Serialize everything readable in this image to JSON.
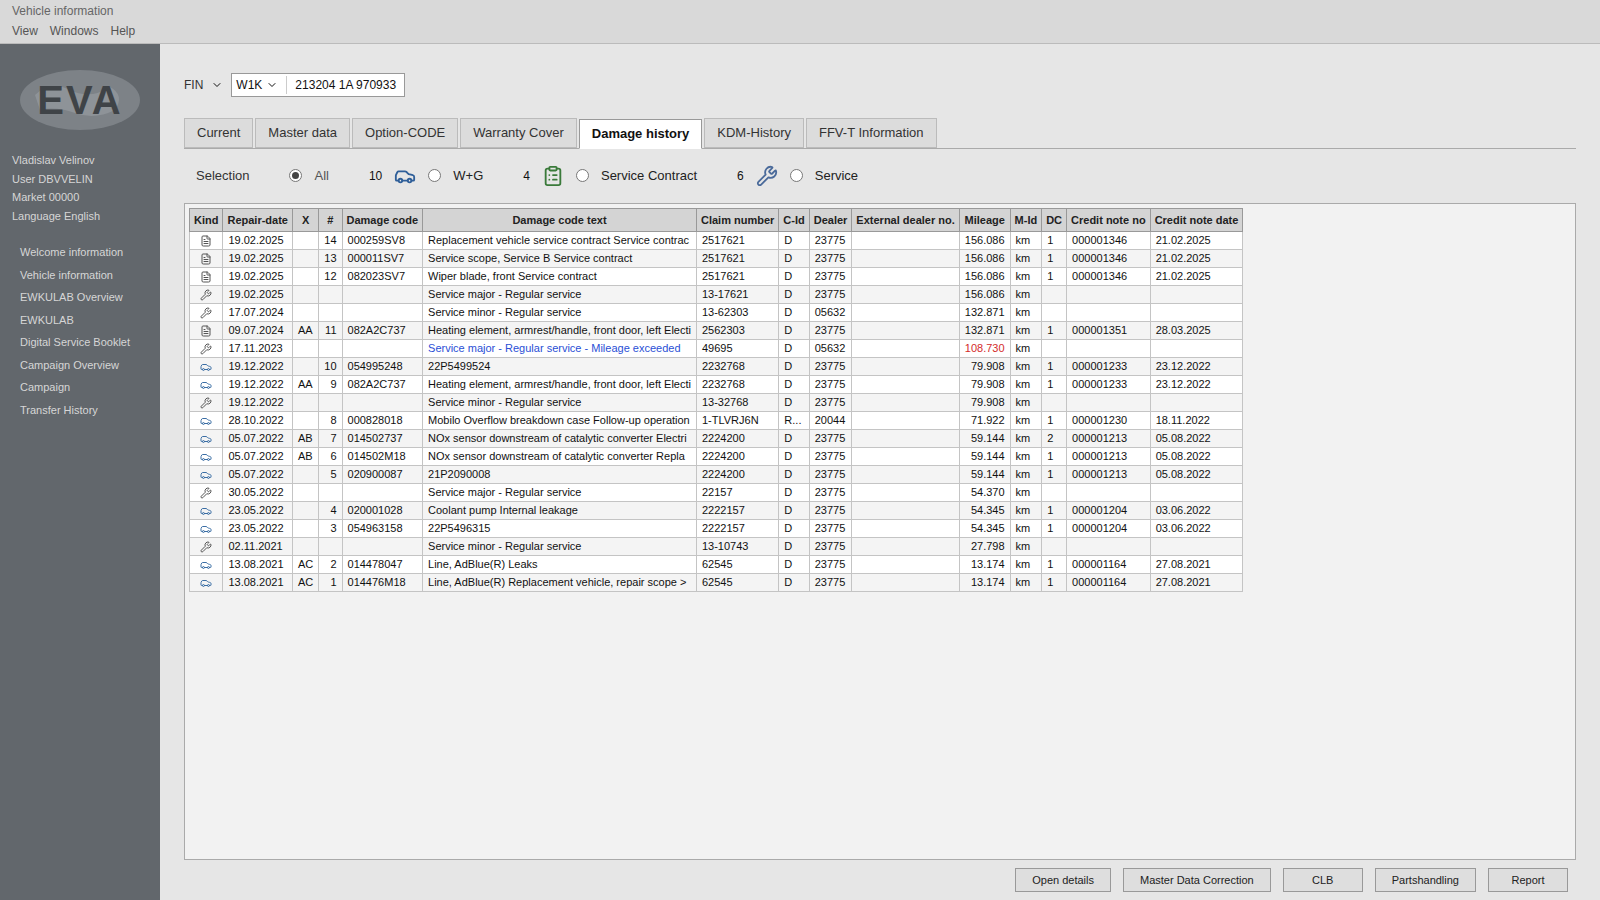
{
  "window": {
    "title": "Vehicle information"
  },
  "menu": [
    "View",
    "Windows",
    "Help"
  ],
  "sidebar": {
    "logo": "EVA",
    "user_lines": [
      "Vladislav Velinov",
      "User DBVVELIN",
      "Market 00000",
      "Language English"
    ],
    "items": [
      "Welcome information",
      "Vehicle information",
      "EWKULAB Overview",
      "EWKULAB",
      "Digital Service Booklet",
      "Campaign Overview",
      "Campaign",
      "Transfer History"
    ]
  },
  "fin": {
    "label": "FIN",
    "prefix": "W1K",
    "value": "213204 1A 970933"
  },
  "tabs": [
    {
      "label": "Current",
      "selected": false
    },
    {
      "label": "Master data",
      "selected": false
    },
    {
      "label": "Option-CODE",
      "selected": false
    },
    {
      "label": "Warranty Cover",
      "selected": false
    },
    {
      "label": "Damage history",
      "selected": true
    },
    {
      "label": "KDM-History",
      "selected": false
    },
    {
      "label": "FFV-T Information",
      "selected": false
    }
  ],
  "selection": {
    "label": "Selection",
    "filters": [
      {
        "label": "All",
        "selected": true,
        "count": "",
        "kind": "none"
      },
      {
        "label": "W+G",
        "selected": false,
        "count": "10",
        "kind": "damage"
      },
      {
        "label": "Service Contract",
        "selected": false,
        "count": "4",
        "kind": "contract"
      },
      {
        "label": "Service",
        "selected": false,
        "count": "6",
        "kind": "service"
      }
    ]
  },
  "table": {
    "columns": [
      {
        "key": "kind",
        "label": "Kind"
      },
      {
        "key": "date",
        "label": "Repair-date"
      },
      {
        "key": "x",
        "label": "X"
      },
      {
        "key": "no",
        "label": "#"
      },
      {
        "key": "code",
        "label": "Damage code"
      },
      {
        "key": "text",
        "label": "Damage code text"
      },
      {
        "key": "claim",
        "label": "Claim number"
      },
      {
        "key": "cid",
        "label": "C-Id"
      },
      {
        "key": "dealer",
        "label": "Dealer"
      },
      {
        "key": "external",
        "label": "External dealer no."
      },
      {
        "key": "mileage",
        "label": "Mileage"
      },
      {
        "key": "unit",
        "label": "M-Id"
      },
      {
        "key": "dc",
        "label": "DC"
      },
      {
        "key": "creditNo",
        "label": "Credit note no"
      },
      {
        "key": "creditDate",
        "label": "Credit note date"
      }
    ],
    "rows": [
      {
        "kind": "contract",
        "date": "19.02.2025",
        "x": "",
        "no": "14",
        "code": "000259SV8",
        "text": "Replacement vehicle service contract Service contrac",
        "claim": "2517621",
        "cid": "D",
        "dealer": "23775",
        "external": "",
        "mileage": "156.086",
        "unit": "km",
        "dc": "1",
        "creditNo": "000001346",
        "creditDate": "21.02.2025",
        "textColor": "#111111",
        "mileageColor": "#111111"
      },
      {
        "kind": "contract",
        "date": "19.02.2025",
        "x": "",
        "no": "13",
        "code": "000011SV7",
        "text": "Service scope, Service B Service contract",
        "claim": "2517621",
        "cid": "D",
        "dealer": "23775",
        "external": "",
        "mileage": "156.086",
        "unit": "km",
        "dc": "1",
        "creditNo": "000001346",
        "creditDate": "21.02.2025",
        "textColor": "#111111",
        "mileageColor": "#111111"
      },
      {
        "kind": "contract",
        "date": "19.02.2025",
        "x": "",
        "no": "12",
        "code": "082023SV7",
        "text": "Wiper blade, front Service contract",
        "claim": "2517621",
        "cid": "D",
        "dealer": "23775",
        "external": "",
        "mileage": "156.086",
        "unit": "km",
        "dc": "1",
        "creditNo": "000001346",
        "creditDate": "21.02.2025",
        "textColor": "#111111",
        "mileageColor": "#111111"
      },
      {
        "kind": "service",
        "date": "19.02.2025",
        "x": "",
        "no": "",
        "code": "",
        "text": "Service major - Regular service",
        "claim": "13-17621",
        "cid": "D",
        "dealer": "23775",
        "external": "",
        "mileage": "156.086",
        "unit": "km",
        "dc": "",
        "creditNo": "",
        "creditDate": "",
        "textColor": "#111111",
        "mileageColor": "#111111"
      },
      {
        "kind": "service",
        "date": "17.07.2024",
        "x": "",
        "no": "",
        "code": "",
        "text": "Service minor - Regular service",
        "claim": "13-62303",
        "cid": "D",
        "dealer": "05632",
        "external": "",
        "mileage": "132.871",
        "unit": "km",
        "dc": "",
        "creditNo": "",
        "creditDate": "",
        "textColor": "#111111",
        "mileageColor": "#111111"
      },
      {
        "kind": "contract",
        "date": "09.07.2024",
        "x": "AA",
        "no": "11",
        "code": "082A2C737",
        "text": "Heating element, armrest/handle, front door, left Electi",
        "claim": "2562303",
        "cid": "D",
        "dealer": "23775",
        "external": "",
        "mileage": "132.871",
        "unit": "km",
        "dc": "1",
        "creditNo": "000001351",
        "creditDate": "28.03.2025",
        "textColor": "#111111",
        "mileageColor": "#111111"
      },
      {
        "kind": "service",
        "date": "17.11.2023",
        "x": "",
        "no": "",
        "code": "",
        "text": "Service major - Regular service - Mileage exceeded",
        "claim": "49695",
        "cid": "D",
        "dealer": "05632",
        "external": "",
        "mileage": "108.730",
        "unit": "km",
        "dc": "",
        "creditNo": "",
        "creditDate": "",
        "textColor": "#2a4fd6",
        "mileageColor": "#d42b2b"
      },
      {
        "kind": "damage",
        "date": "19.12.2022",
        "x": "",
        "no": "10",
        "code": "054995248",
        "text": "22P5499524",
        "claim": "2232768",
        "cid": "D",
        "dealer": "23775",
        "external": "",
        "mileage": "79.908",
        "unit": "km",
        "dc": "1",
        "creditNo": "000001233",
        "creditDate": "23.12.2022",
        "textColor": "#111111",
        "mileageColor": "#111111"
      },
      {
        "kind": "damage",
        "date": "19.12.2022",
        "x": "AA",
        "no": "9",
        "code": "082A2C737",
        "text": "Heating element, armrest/handle, front door, left Electi",
        "claim": "2232768",
        "cid": "D",
        "dealer": "23775",
        "external": "",
        "mileage": "79.908",
        "unit": "km",
        "dc": "1",
        "creditNo": "000001233",
        "creditDate": "23.12.2022",
        "textColor": "#111111",
        "mileageColor": "#111111"
      },
      {
        "kind": "service",
        "date": "19.12.2022",
        "x": "",
        "no": "",
        "code": "",
        "text": "Service minor - Regular service",
        "claim": "13-32768",
        "cid": "D",
        "dealer": "23775",
        "external": "",
        "mileage": "79.908",
        "unit": "km",
        "dc": "",
        "creditNo": "",
        "creditDate": "",
        "textColor": "#111111",
        "mileageColor": "#111111"
      },
      {
        "kind": "damage",
        "date": "28.10.2022",
        "x": "",
        "no": "8",
        "code": "000828018",
        "text": "Mobilo Overflow breakdown case Follow-up operation",
        "claim": "1-TLVRJ6N",
        "cid": "R...",
        "dealer": "20044",
        "external": "",
        "mileage": "71.922",
        "unit": "km",
        "dc": "1",
        "creditNo": "000001230",
        "creditDate": "18.11.2022",
        "textColor": "#111111",
        "mileageColor": "#111111"
      },
      {
        "kind": "damage",
        "date": "05.07.2022",
        "x": "AB",
        "no": "7",
        "code": "014502737",
        "text": "NOx sensor downstream of catalytic converter Electri",
        "claim": "2224200",
        "cid": "D",
        "dealer": "23775",
        "external": "",
        "mileage": "59.144",
        "unit": "km",
        "dc": "2",
        "creditNo": "000001213",
        "creditDate": "05.08.2022",
        "textColor": "#111111",
        "mileageColor": "#111111"
      },
      {
        "kind": "damage",
        "date": "05.07.2022",
        "x": "AB",
        "no": "6",
        "code": "014502M18",
        "text": "NOx sensor downstream of catalytic converter Repla",
        "claim": "2224200",
        "cid": "D",
        "dealer": "23775",
        "external": "",
        "mileage": "59.144",
        "unit": "km",
        "dc": "1",
        "creditNo": "000001213",
        "creditDate": "05.08.2022",
        "textColor": "#111111",
        "mileageColor": "#111111"
      },
      {
        "kind": "damage",
        "date": "05.07.2022",
        "x": "",
        "no": "5",
        "code": "020900087",
        "text": "21P2090008",
        "claim": "2224200",
        "cid": "D",
        "dealer": "23775",
        "external": "",
        "mileage": "59.144",
        "unit": "km",
        "dc": "1",
        "creditNo": "000001213",
        "creditDate": "05.08.2022",
        "textColor": "#111111",
        "mileageColor": "#111111"
      },
      {
        "kind": "service",
        "date": "30.05.2022",
        "x": "",
        "no": "",
        "code": "",
        "text": "Service major - Regular service",
        "claim": "22157",
        "cid": "D",
        "dealer": "23775",
        "external": "",
        "mileage": "54.370",
        "unit": "km",
        "dc": "",
        "creditNo": "",
        "creditDate": "",
        "textColor": "#111111",
        "mileageColor": "#111111"
      },
      {
        "kind": "damage",
        "date": "23.05.2022",
        "x": "",
        "no": "4",
        "code": "020001028",
        "text": "Coolant pump Internal leakage",
        "claim": "2222157",
        "cid": "D",
        "dealer": "23775",
        "external": "",
        "mileage": "54.345",
        "unit": "km",
        "dc": "1",
        "creditNo": "000001204",
        "creditDate": "03.06.2022",
        "textColor": "#111111",
        "mileageColor": "#111111"
      },
      {
        "kind": "damage",
        "date": "23.05.2022",
        "x": "",
        "no": "3",
        "code": "054963158",
        "text": "22P5496315",
        "claim": "2222157",
        "cid": "D",
        "dealer": "23775",
        "external": "",
        "mileage": "54.345",
        "unit": "km",
        "dc": "1",
        "creditNo": "000001204",
        "creditDate": "03.06.2022",
        "textColor": "#111111",
        "mileageColor": "#111111"
      },
      {
        "kind": "service",
        "date": "02.11.2021",
        "x": "",
        "no": "",
        "code": "",
        "text": "Service minor - Regular service",
        "claim": "13-10743",
        "cid": "D",
        "dealer": "23775",
        "external": "",
        "mileage": "27.798",
        "unit": "km",
        "dc": "",
        "creditNo": "",
        "creditDate": "",
        "textColor": "#111111",
        "mileageColor": "#111111"
      },
      {
        "kind": "damage",
        "date": "13.08.2021",
        "x": "AC",
        "no": "2",
        "code": "014478047",
        "text": "Line, AdBlue(R) Leaks",
        "claim": "62545",
        "cid": "D",
        "dealer": "23775",
        "external": "",
        "mileage": "13.174",
        "unit": "km",
        "dc": "1",
        "creditNo": "000001164",
        "creditDate": "27.08.2021",
        "textColor": "#111111",
        "mileageColor": "#111111"
      },
      {
        "kind": "damage",
        "date": "13.08.2021",
        "x": "AC",
        "no": "1",
        "code": "014476M18",
        "text": "Line, AdBlue(R) Replacement vehicle, repair scope >",
        "claim": "62545",
        "cid": "D",
        "dealer": "23775",
        "external": "",
        "mileage": "13.174",
        "unit": "km",
        "dc": "1",
        "creditNo": "000001164",
        "creditDate": "27.08.2021",
        "textColor": "#111111",
        "mileageColor": "#111111"
      }
    ]
  },
  "buttons": [
    "Open details",
    "Master Data Correction",
    "CLB",
    "Partshandling",
    "Report"
  ]
}
